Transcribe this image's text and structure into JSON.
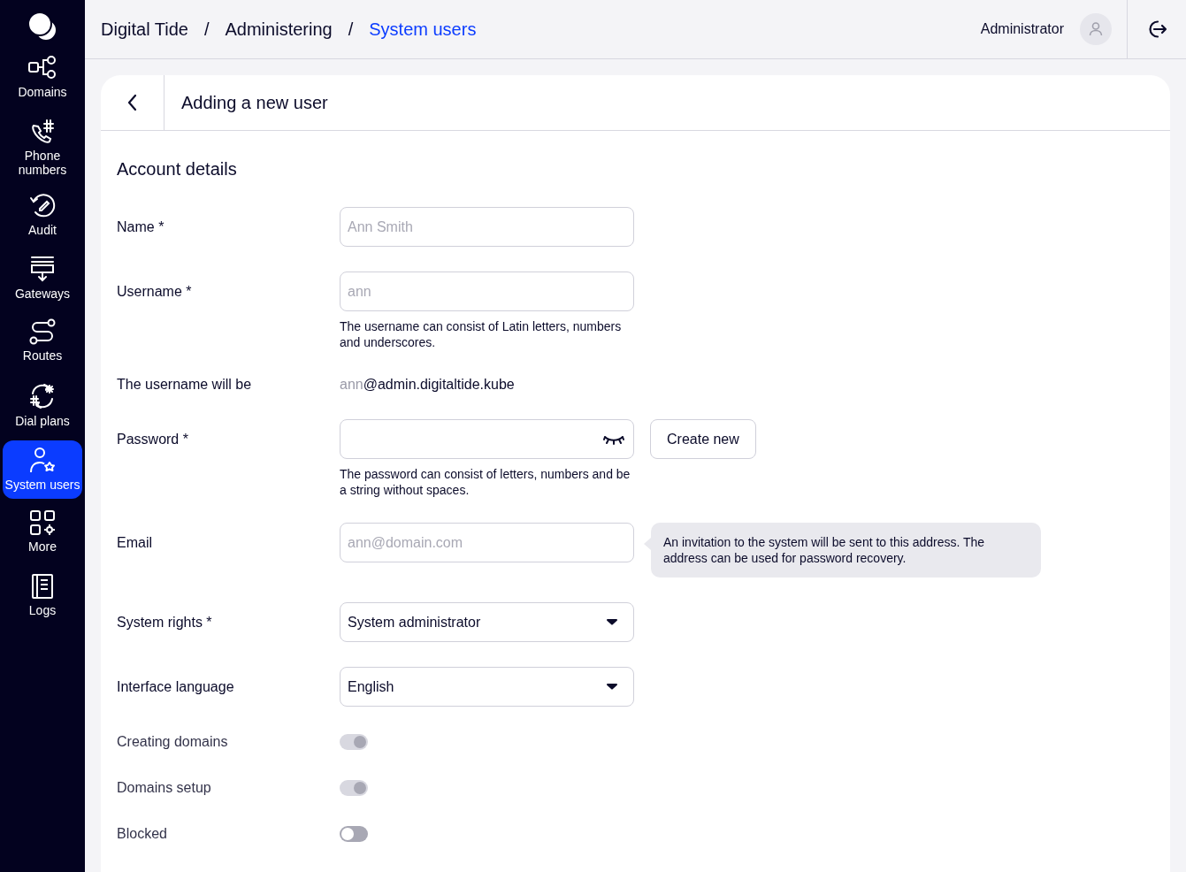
{
  "sidebar": {
    "items": [
      {
        "label": "Domains",
        "selected": false
      },
      {
        "label": "Phone numbers",
        "selected": false
      },
      {
        "label": "Audit",
        "selected": false
      },
      {
        "label": "Gateways",
        "selected": false
      },
      {
        "label": "Routes",
        "selected": false
      },
      {
        "label": "Dial plans",
        "selected": false
      },
      {
        "label": "System users",
        "selected": true
      },
      {
        "label": "More",
        "selected": false
      },
      {
        "label": "Logs",
        "selected": false
      }
    ]
  },
  "breadcrumbs": [
    {
      "label": "Digital Tide",
      "current": false
    },
    {
      "label": "Administering",
      "current": false
    },
    {
      "label": "System users",
      "current": true
    }
  ],
  "breadcrumb_separator": "/",
  "user": {
    "name": "Administrator"
  },
  "page": {
    "title": "Adding a new user",
    "section": "Account details"
  },
  "fields": [
    {
      "kind": "input",
      "label": "Name *",
      "placeholder": "Ann Smith"
    },
    {
      "kind": "input",
      "label": "Username *",
      "placeholder": "ann",
      "hint": "The username can consist of Latin letters, numbers and underscores."
    },
    {
      "kind": "preview",
      "label": "The username will be",
      "prefix": "ann",
      "suffix": "@admin.digitaltide.kube"
    },
    {
      "kind": "password",
      "label": "Password *",
      "button": "Create new",
      "hint": "The password can consist of letters, numbers and be a string without spaces."
    },
    {
      "kind": "input",
      "label": "Email",
      "placeholder": "ann@domain.com",
      "tooltip": "An invitation to the system will be sent to this address. The address can be used for password recovery."
    },
    {
      "kind": "select",
      "label": "System rights *",
      "value": "System administrator"
    },
    {
      "kind": "select",
      "label": "Interface language",
      "value": "English"
    },
    {
      "kind": "toggle",
      "label": "Creating domains",
      "on": true,
      "disabled": true
    },
    {
      "kind": "toggle",
      "label": "Domains setup",
      "on": true,
      "disabled": true
    },
    {
      "kind": "toggle",
      "label": "Blocked",
      "on": false,
      "disabled": false
    }
  ]
}
